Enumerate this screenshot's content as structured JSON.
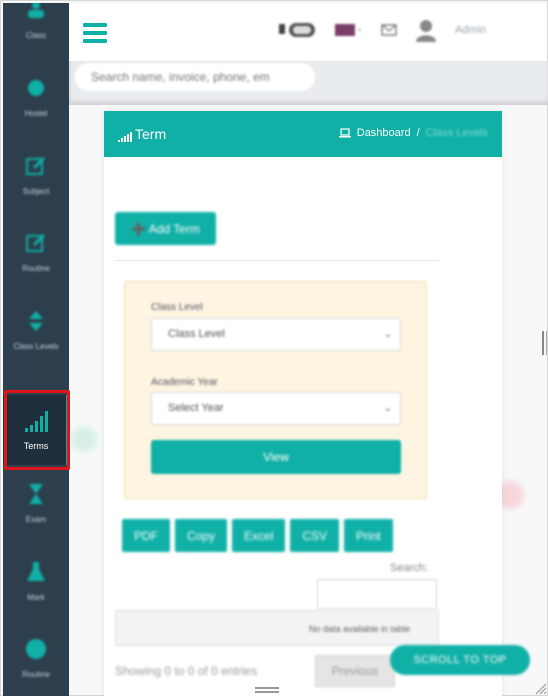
{
  "sidebar": {
    "items": [
      {
        "label": "Class",
        "icon": "class-icon"
      },
      {
        "label": "Hostel",
        "icon": "hostel-icon"
      },
      {
        "label": "Subject",
        "icon": "subject-icon"
      },
      {
        "label": "Routine",
        "icon": "routine-icon"
      },
      {
        "label": "Class Levels",
        "icon": "class-levels-icon"
      },
      {
        "label": "Terms",
        "icon": "signal-bars-icon"
      },
      {
        "label": "Exam",
        "icon": "hourglass-icon"
      },
      {
        "label": "Mark",
        "icon": "flask-icon"
      },
      {
        "label": "Routine",
        "icon": "globe-icon"
      }
    ]
  },
  "header": {
    "admin_label": "Admin",
    "search_placeholder": "Search name, invoice, phone, em"
  },
  "card": {
    "title": "Term",
    "breadcrumb": {
      "home": "Dashboard",
      "separator": "/",
      "current": "Class Levels"
    },
    "add_button": "Add Term",
    "filter": {
      "class_level_label": "Class Level",
      "class_level_value": "Class Level",
      "academic_year_label": "Academic Year",
      "academic_year_value": "Select Year",
      "view_button": "View"
    },
    "export_buttons": [
      "PDF",
      "Copy",
      "Excel",
      "CSV",
      "Print"
    ],
    "search_label": "Search:",
    "empty_message": "No data available in table",
    "showing": "Showing 0 to 0 of 0 entries",
    "previous": "Previous"
  },
  "scroll_to_top": "SCROLL TO TOP",
  "colors": {
    "accent": "#10b0a7",
    "sidebar": "#2d3e4d",
    "highlight": "#e0151b",
    "filter_bg": "#fdf4e1"
  }
}
